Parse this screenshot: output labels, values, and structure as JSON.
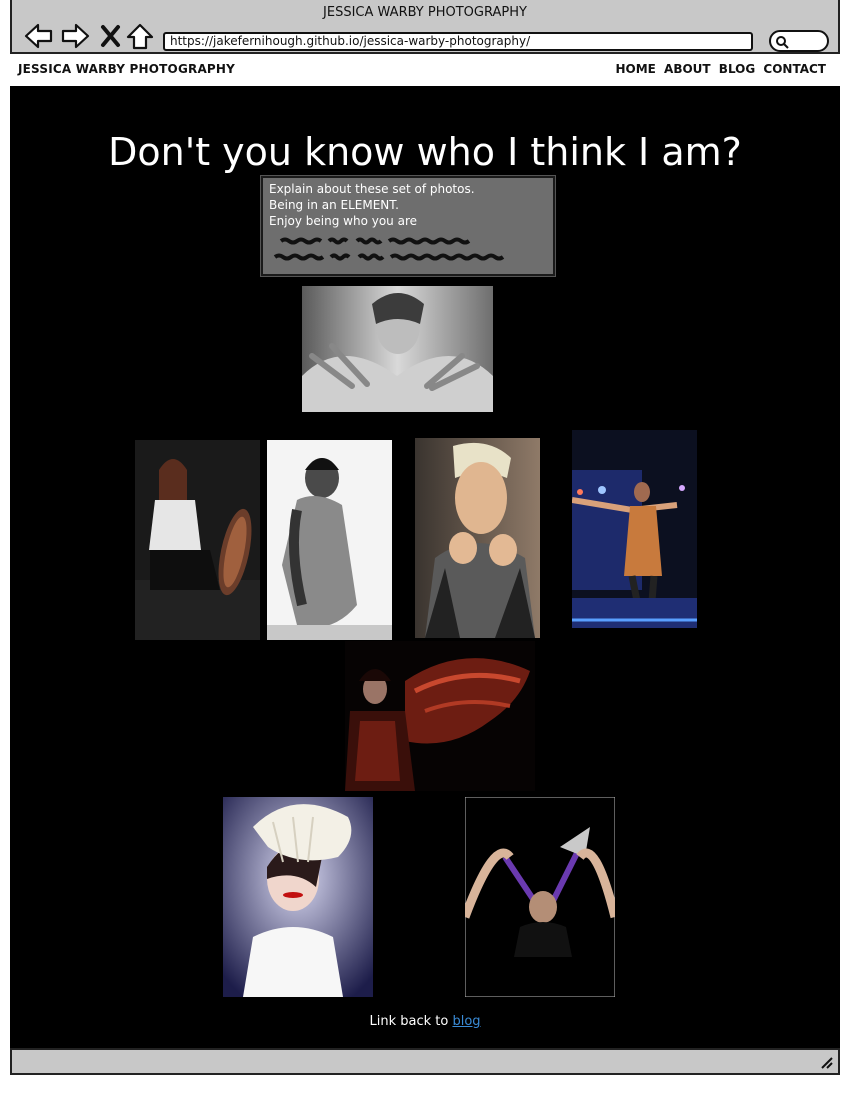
{
  "window": {
    "title": "JESSICA WARBY PHOTOGRAPHY",
    "url": "https://jakefernihough.github.io/jessica-warby-photography/"
  },
  "header": {
    "brand": "JESSICA WARBY PHOTOGRAPHY",
    "nav": [
      "HOME",
      "ABOUT",
      "BLOG",
      "CONTACT"
    ]
  },
  "main": {
    "headline": "Don't you know who I think I am?",
    "description": [
      "Explain about these set of photos.",
      "Being in an ELEMENT.",
      "Enjoy being who you are"
    ]
  },
  "footer": {
    "prefix": "Link back to",
    "link": "blog"
  }
}
